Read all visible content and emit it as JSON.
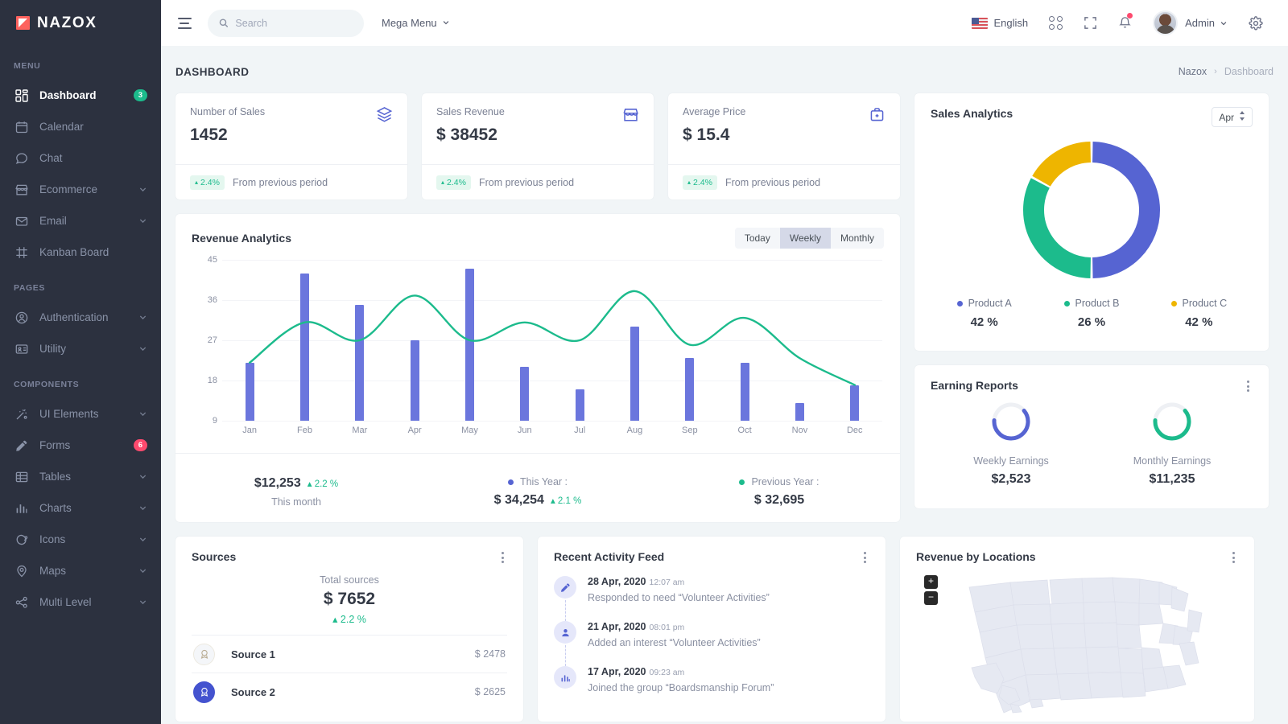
{
  "brand": {
    "name": "NAZOX"
  },
  "sidebar": {
    "sections": [
      {
        "title": "MENU",
        "items": [
          {
            "label": "Dashboard",
            "icon": "grid-icon",
            "badge": "3",
            "badge_color": "#1cbb8c",
            "active": true
          },
          {
            "label": "Calendar",
            "icon": "calendar-icon"
          },
          {
            "label": "Chat",
            "icon": "chat-icon"
          },
          {
            "label": "Ecommerce",
            "icon": "store-icon",
            "chevron": true
          },
          {
            "label": "Email",
            "icon": "mail-icon",
            "chevron": true
          },
          {
            "label": "Kanban Board",
            "icon": "kanban-icon"
          }
        ]
      },
      {
        "title": "PAGES",
        "items": [
          {
            "label": "Authentication",
            "icon": "user-circle-icon",
            "chevron": true
          },
          {
            "label": "Utility",
            "icon": "id-card-icon",
            "chevron": true
          }
        ]
      },
      {
        "title": "COMPONENTS",
        "items": [
          {
            "label": "UI Elements",
            "icon": "wand-icon",
            "chevron": true
          },
          {
            "label": "Forms",
            "icon": "pen-icon",
            "badge": "6",
            "badge_color": "#fd4a6e"
          },
          {
            "label": "Tables",
            "icon": "table-icon",
            "chevron": true
          },
          {
            "label": "Charts",
            "icon": "bar-chart-icon",
            "chevron": true
          },
          {
            "label": "Icons",
            "icon": "planet-icon",
            "chevron": true
          },
          {
            "label": "Maps",
            "icon": "map-pin-icon",
            "chevron": true
          },
          {
            "label": "Multi Level",
            "icon": "share-icon",
            "chevron": true
          }
        ]
      }
    ]
  },
  "topbar": {
    "search_placeholder": "Search",
    "search_value": "",
    "mega_menu": "Mega Menu",
    "language": "English",
    "user": "Admin"
  },
  "page": {
    "title": "DASHBOARD",
    "breadcrumb": {
      "root": "Nazox",
      "sep": "›",
      "current": "Dashboard"
    }
  },
  "stats": [
    {
      "label": "Number of Sales",
      "value": "1452",
      "icon": "layers-icon",
      "delta": "2.4%",
      "delta_arrow": "▴",
      "foot": "From previous period"
    },
    {
      "label": "Sales Revenue",
      "value": "$ 38452",
      "icon": "store-icon",
      "delta": "2.4%",
      "delta_arrow": "▴",
      "foot": "From previous period"
    },
    {
      "label": "Average Price",
      "value": "$ 15.4",
      "icon": "briefcase-icon",
      "delta": "2.4%",
      "delta_arrow": "▴",
      "foot": "From previous period"
    }
  ],
  "revenue": {
    "title": "Revenue Analytics",
    "tabs": [
      {
        "label": "Today",
        "active": false
      },
      {
        "label": "Weekly",
        "active": true
      },
      {
        "label": "Monthly",
        "active": false
      }
    ],
    "footer": {
      "month_value": "$12,253",
      "month_pct": "2.2 %",
      "month_label": "This month",
      "this_year_label": "This Year :",
      "this_year_value": "$ 34,254",
      "this_year_pct": "2.1 %",
      "prev_year_label": "Previous Year :",
      "prev_year_value": "$ 32,695",
      "this_year_color": "#5664d2",
      "prev_year_color": "#1cbb8c"
    }
  },
  "chart_data": [
    {
      "type": "bar",
      "title": "Revenue Analytics",
      "categories": [
        "Jan",
        "Feb",
        "Mar",
        "Apr",
        "May",
        "Jun",
        "Jul",
        "Aug",
        "Sep",
        "Oct",
        "Nov",
        "Dec"
      ],
      "yticks": [
        9,
        18,
        27,
        36,
        45
      ],
      "ylim": [
        9,
        45
      ],
      "xlabel": "",
      "ylabel": "",
      "grid": true,
      "legend": "bottom",
      "series": [
        {
          "name": "This Year",
          "type": "bar",
          "color": "#6b76dd",
          "values": [
            22,
            42,
            35,
            27,
            43,
            21,
            16,
            30,
            23,
            22,
            13,
            17
          ]
        },
        {
          "name": "Previous Year",
          "type": "line",
          "color": "#1cbb8c",
          "values": [
            22,
            31,
            27,
            37,
            27,
            31,
            27,
            38,
            26,
            32,
            23,
            17
          ]
        }
      ]
    },
    {
      "type": "pie",
      "title": "Sales Analytics",
      "labels": [
        "Product A",
        "Product B",
        "Product C"
      ],
      "display_values": [
        "42 %",
        "26 %",
        "42 %"
      ],
      "slice_fractions": [
        0.5,
        0.33,
        0.17
      ],
      "colors": [
        "#5664d2",
        "#1cbb8c",
        "#eeb500"
      ]
    },
    {
      "type": "pie",
      "title": "Weekly Earnings",
      "labels": [
        "Weekly Earnings"
      ],
      "values": [
        62
      ],
      "ylim": [
        0,
        100
      ],
      "colors": [
        "#5664d2"
      ]
    },
    {
      "type": "pie",
      "title": "Monthly Earnings",
      "labels": [
        "Monthly Earnings"
      ],
      "values": [
        62
      ],
      "ylim": [
        0,
        100
      ],
      "colors": [
        "#1cbb8c"
      ]
    }
  ],
  "sales_analytics": {
    "title": "Sales Analytics",
    "period": "Apr",
    "legend": [
      {
        "label": "Product A",
        "value": "42 %",
        "color": "#5664d2"
      },
      {
        "label": "Product B",
        "value": "26 %",
        "color": "#1cbb8c"
      },
      {
        "label": "Product C",
        "value": "42 %",
        "color": "#eeb500"
      }
    ]
  },
  "earning": {
    "title": "Earning Reports",
    "items": [
      {
        "label": "Weekly Earnings",
        "value": "$2,523",
        "color": "#5664d2"
      },
      {
        "label": "Monthly Earnings",
        "value": "$11,235",
        "color": "#1cbb8c"
      }
    ]
  },
  "sources": {
    "title": "Sources",
    "total_label": "Total sources",
    "total_value": "$ 7652",
    "total_pct": "2.2 %",
    "rows": [
      {
        "name": "Source 1",
        "value": "$ 2478",
        "icon": "badge-icon"
      },
      {
        "name": "Source 2",
        "value": "$ 2625",
        "icon": "badge-icon"
      }
    ]
  },
  "activity": {
    "title": "Recent Activity Feed",
    "items": [
      {
        "date": "28 Apr, 2020",
        "time": "12:07 am",
        "text": "Responded to need “Volunteer Activities”",
        "icon": "pencil-icon"
      },
      {
        "date": "21 Apr, 2020",
        "time": "08:01 pm",
        "text": "Added an interest “Volunteer Activities”",
        "icon": "user-icon"
      },
      {
        "date": "17 Apr, 2020",
        "time": "09:23 am",
        "text": "Joined the group “Boardsmanship Forum”",
        "icon": "chart-icon"
      }
    ]
  },
  "locations": {
    "title": "Revenue by Locations",
    "zoom_in": "+",
    "zoom_out": "−"
  }
}
